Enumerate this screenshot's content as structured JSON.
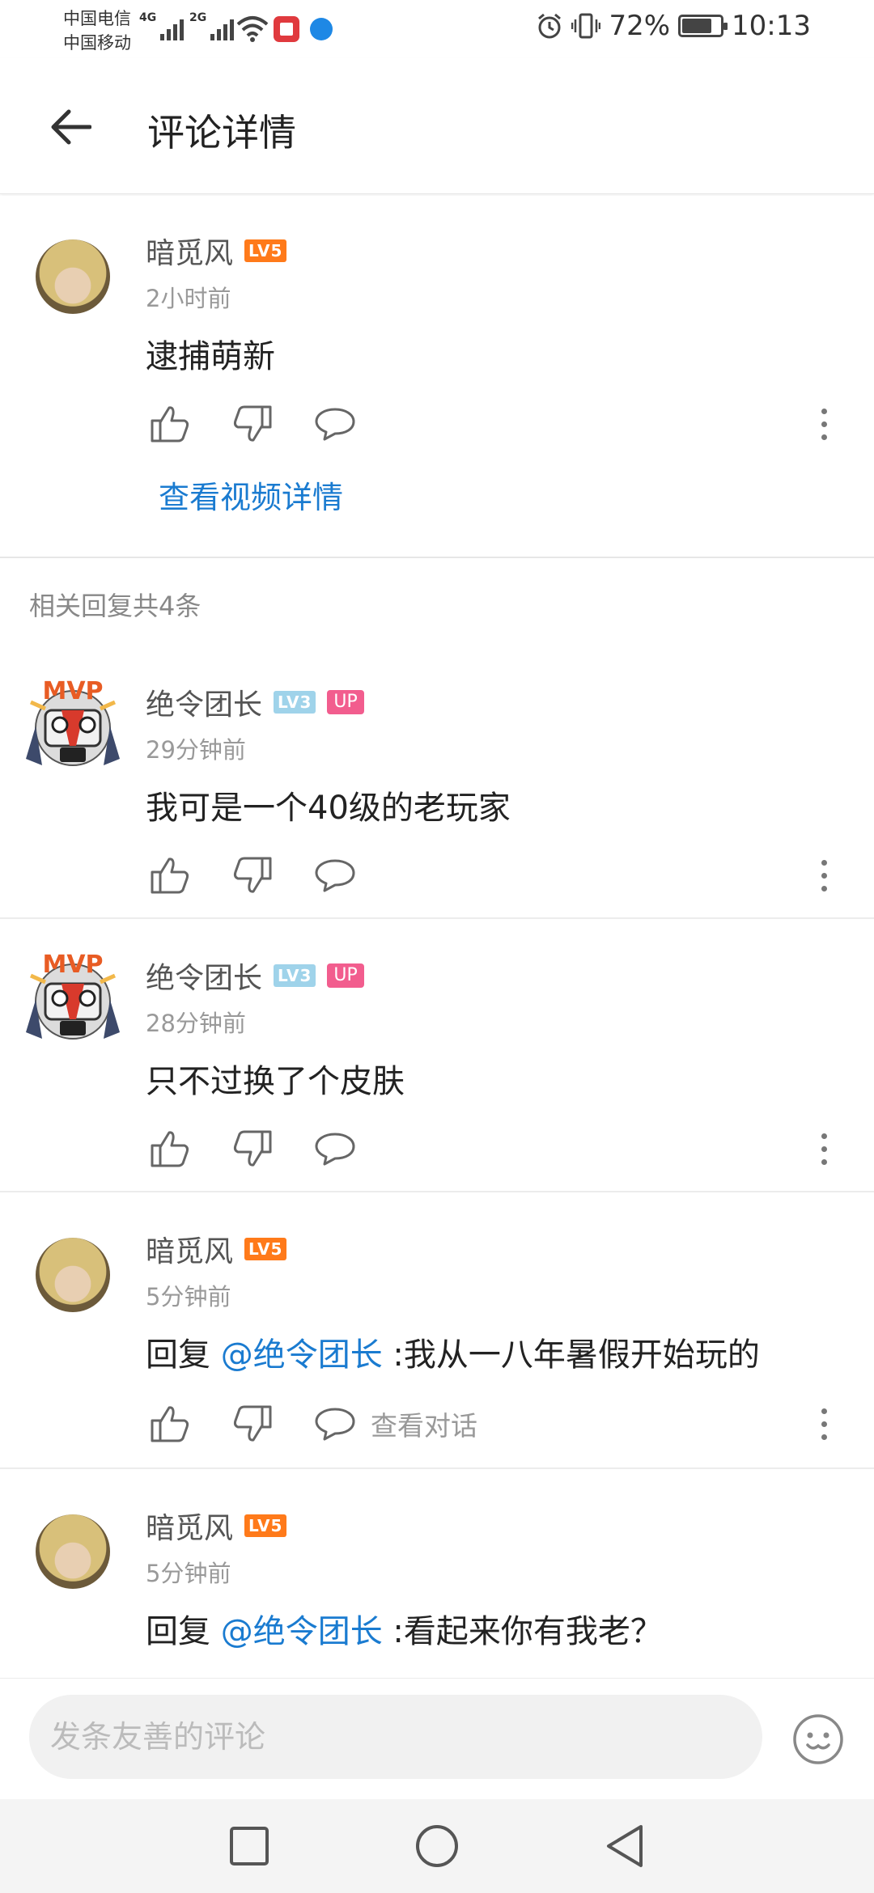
{
  "status_bar": {
    "carrier1": "中国电信",
    "carrier2": "中国移动",
    "net1": "4G",
    "net2": "2G",
    "battery": "72%",
    "time": "10:13"
  },
  "header": {
    "title": "评论详情"
  },
  "main_comment": {
    "username": "暗觅风",
    "level": "LV5",
    "time": "2小时前",
    "text": "逮捕萌新",
    "video_link": "查看视频详情"
  },
  "replies_label": "相关回复共4条",
  "replies": [
    {
      "username": "绝令团长",
      "level": "LV3",
      "up": "UP",
      "time": "29分钟前",
      "text": "我可是一个40级的老玩家"
    },
    {
      "username": "绝令团长",
      "level": "LV3",
      "up": "UP",
      "time": "28分钟前",
      "text": "只不过换了个皮肤"
    },
    {
      "username": "暗觅风",
      "level": "LV5",
      "time": "5分钟前",
      "reply_prefix": "回复",
      "mention": "@绝令团长",
      "text": " :我从一八年暑假开始玩的",
      "view_convo": "查看对话"
    },
    {
      "username": "暗觅风",
      "level": "LV5",
      "time": "5分钟前",
      "reply_prefix": "回复",
      "mention": "@绝令团长",
      "text": " :看起来你有我老？"
    }
  ],
  "input": {
    "placeholder": "发条友善的评论"
  },
  "colors": {
    "link_blue": "#1a7bd0",
    "lv5_orange": "#ff7a1a",
    "lv3_blue": "#9fd3ea",
    "up_pink": "#f25d8e"
  }
}
